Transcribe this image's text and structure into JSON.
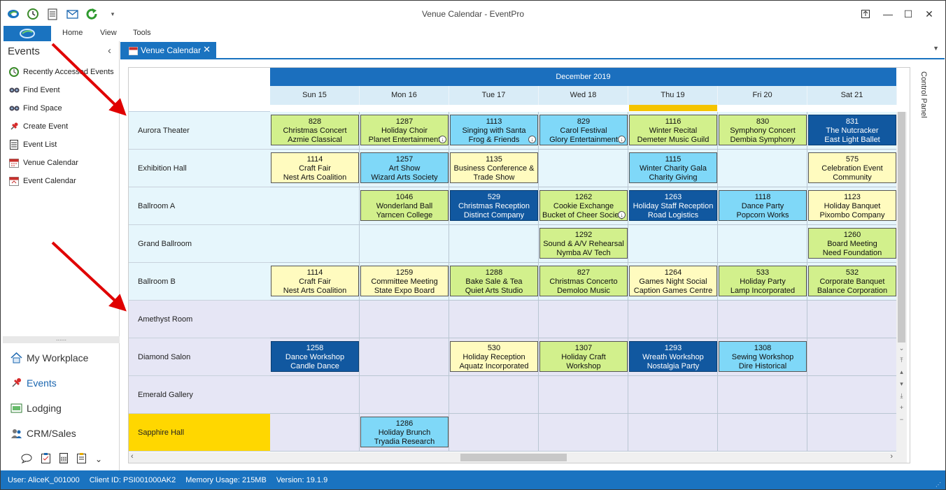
{
  "window": {
    "title": "Venue Calendar - EventPro",
    "quick_access": [
      "back-icon",
      "clock-icon",
      "document-icon",
      "mail-icon",
      "refresh-icon",
      "customize-icon"
    ],
    "controls": [
      "restore-to-top-icon",
      "minimize-icon",
      "maximize-icon",
      "close-icon"
    ]
  },
  "ribbon": {
    "tabs": [
      "Home",
      "View",
      "Tools"
    ]
  },
  "nav": {
    "header": "Events",
    "items": [
      {
        "label": "Recently Accessed Events",
        "icon": "clock-icon"
      },
      {
        "label": "Find Event",
        "icon": "binoculars-icon"
      },
      {
        "label": "Find Space",
        "icon": "binoculars-icon"
      },
      {
        "label": "Create Event",
        "icon": "pushpin-icon"
      },
      {
        "label": "Event List",
        "icon": "list-document-icon"
      },
      {
        "label": "Venue Calendar",
        "icon": "calendar-icon"
      },
      {
        "label": "Event Calendar",
        "icon": "calendar-icon"
      }
    ],
    "splitter": "......",
    "modules": [
      {
        "label": "My Workplace",
        "icon": "house-icon"
      },
      {
        "label": "Events",
        "icon": "pushpin-icon"
      },
      {
        "label": "Lodging",
        "icon": "bed-icon"
      },
      {
        "label": "CRM/Sales",
        "icon": "people-icon"
      }
    ],
    "bottom_icons": [
      "chat-bubble-icon",
      "clipboard-check-icon",
      "calculator-icon",
      "clipboard-icon",
      "chevron-down-icon"
    ]
  },
  "doc_tab": {
    "label": "Venue Calendar"
  },
  "calendar": {
    "month": "December 2019",
    "days": [
      "Sun 15",
      "Mon 16",
      "Tue 17",
      "Wed 18",
      "Thu 19",
      "Fri 20",
      "Sat 21"
    ],
    "today_index": 4,
    "rooms": [
      {
        "name": "Aurora Theater",
        "highlight": false
      },
      {
        "name": "Exhibition Hall",
        "highlight": false
      },
      {
        "name": "Ballroom A",
        "highlight": false
      },
      {
        "name": "Grand Ballroom",
        "highlight": false
      },
      {
        "name": "Ballroom B",
        "highlight": false
      },
      {
        "name": "Amethyst Room",
        "highlight": false
      },
      {
        "name": "Diamond Salon",
        "highlight": false
      },
      {
        "name": "Emerald Gallery",
        "highlight": false
      },
      {
        "name": "Sapphire Hall",
        "highlight": true
      }
    ],
    "events": [
      {
        "row": 0,
        "day": 0,
        "color": "g",
        "lines": [
          "828",
          "Christmas Concert",
          "Azmie Classical"
        ]
      },
      {
        "row": 0,
        "day": 1,
        "color": "g",
        "lines": [
          "1287",
          "Holiday Choir",
          "Planet Entertainment"
        ],
        "dl": true
      },
      {
        "row": 0,
        "day": 2,
        "color": "c",
        "lines": [
          "1113",
          "Singing with Santa",
          "Frog & Friends"
        ],
        "dl": true
      },
      {
        "row": 0,
        "day": 3,
        "color": "c",
        "lines": [
          "829",
          "Carol Festival",
          "Glory Entertainment"
        ],
        "dl": true
      },
      {
        "row": 0,
        "day": 4,
        "color": "g",
        "lines": [
          "1116",
          "Winter Recital",
          "Demeter Music Guild"
        ]
      },
      {
        "row": 0,
        "day": 5,
        "color": "g",
        "lines": [
          "830",
          "Symphony Concert",
          "Dembia Symphony"
        ]
      },
      {
        "row": 0,
        "day": 6,
        "color": "d",
        "lines": [
          "831",
          "The Nutcracker",
          "East Light Ballet"
        ]
      },
      {
        "row": 1,
        "day": 0,
        "color": "y",
        "lines": [
          "1114",
          "Craft Fair",
          "Nest Arts Coalition"
        ]
      },
      {
        "row": 1,
        "day": 1,
        "color": "c",
        "lines": [
          "1257",
          "Art Show",
          "Wizard Arts Society"
        ]
      },
      {
        "row": 1,
        "day": 2,
        "color": "y",
        "lines": [
          "1135",
          "Business Conference &",
          "Trade Show"
        ]
      },
      {
        "row": 1,
        "day": 4,
        "color": "c",
        "lines": [
          "1115",
          "Winter Charity Gala",
          "Charity Giving"
        ]
      },
      {
        "row": 1,
        "day": 6,
        "color": "y",
        "lines": [
          "575",
          "Celebration Event",
          "Community"
        ]
      },
      {
        "row": 2,
        "day": 1,
        "color": "g",
        "lines": [
          "1046",
          "Wonderland Ball",
          "Yarncen College"
        ]
      },
      {
        "row": 2,
        "day": 2,
        "color": "d",
        "lines": [
          "529",
          "Christmas Reception",
          "Distinct Company"
        ]
      },
      {
        "row": 2,
        "day": 3,
        "color": "g",
        "lines": [
          "1262",
          "Cookie Exchange",
          "Bucket of Cheer Society"
        ],
        "dl": true
      },
      {
        "row": 2,
        "day": 4,
        "color": "d",
        "lines": [
          "1263",
          "Holiday Staff Reception",
          "Road Logistics"
        ]
      },
      {
        "row": 2,
        "day": 5,
        "color": "c",
        "lines": [
          "1118",
          "Dance Party",
          "Popcorn Works"
        ]
      },
      {
        "row": 2,
        "day": 6,
        "color": "y",
        "lines": [
          "1123",
          "Holiday Banquet",
          "Pixombo Company"
        ]
      },
      {
        "row": 3,
        "day": 3,
        "color": "g",
        "lines": [
          "1292",
          "Sound & A/V Rehearsal",
          "Nymba AV Tech"
        ]
      },
      {
        "row": 3,
        "day": 6,
        "color": "g",
        "lines": [
          "1260",
          "Board Meeting",
          "Need Foundation"
        ]
      },
      {
        "row": 4,
        "day": 0,
        "color": "y",
        "lines": [
          "1114",
          "Craft Fair",
          "Nest Arts Coalition"
        ]
      },
      {
        "row": 4,
        "day": 1,
        "color": "y",
        "lines": [
          "1259",
          "Committee Meeting",
          "State Expo Board"
        ]
      },
      {
        "row": 4,
        "day": 2,
        "color": "g",
        "lines": [
          "1288",
          "Bake Sale & Tea",
          "Quiet Arts Studio"
        ]
      },
      {
        "row": 4,
        "day": 3,
        "color": "g",
        "lines": [
          "827",
          "Christmas Concerto",
          "Demoloo Music"
        ]
      },
      {
        "row": 4,
        "day": 4,
        "color": "y",
        "lines": [
          "1264",
          "Games Night Social",
          "Caption Games Centre"
        ]
      },
      {
        "row": 4,
        "day": 5,
        "color": "g",
        "lines": [
          "533",
          "Holiday Party",
          "Lamp Incorporated"
        ]
      },
      {
        "row": 4,
        "day": 6,
        "color": "g",
        "lines": [
          "532",
          "Corporate Banquet",
          "Balance Corporation"
        ]
      },
      {
        "row": 6,
        "day": 0,
        "color": "d",
        "lines": [
          "1258",
          "Dance Workshop",
          "Candle Dance"
        ]
      },
      {
        "row": 6,
        "day": 2,
        "color": "y",
        "lines": [
          "530",
          "Holiday Reception",
          "Aquatz Incorporated"
        ]
      },
      {
        "row": 6,
        "day": 3,
        "color": "g",
        "lines": [
          "1307",
          "Holiday Craft",
          "Workshop"
        ]
      },
      {
        "row": 6,
        "day": 4,
        "color": "d",
        "lines": [
          "1293",
          "Wreath Workshop",
          "Nostalgia Party"
        ]
      },
      {
        "row": 6,
        "day": 5,
        "color": "c",
        "lines": [
          "1308",
          "Sewing Workshop",
          "Dire Historical"
        ]
      },
      {
        "row": 8,
        "day": 1,
        "color": "c",
        "lines": [
          "1286",
          "Holiday Brunch",
          "Tryadia Research"
        ]
      }
    ]
  },
  "control_panel": {
    "label": "Control Panel"
  },
  "status": {
    "user": "User: AliceK_001000",
    "client": "Client ID: PSI001000AK2",
    "memory": "Memory Usage: 215MB",
    "version": "Version: 19.1.9"
  }
}
